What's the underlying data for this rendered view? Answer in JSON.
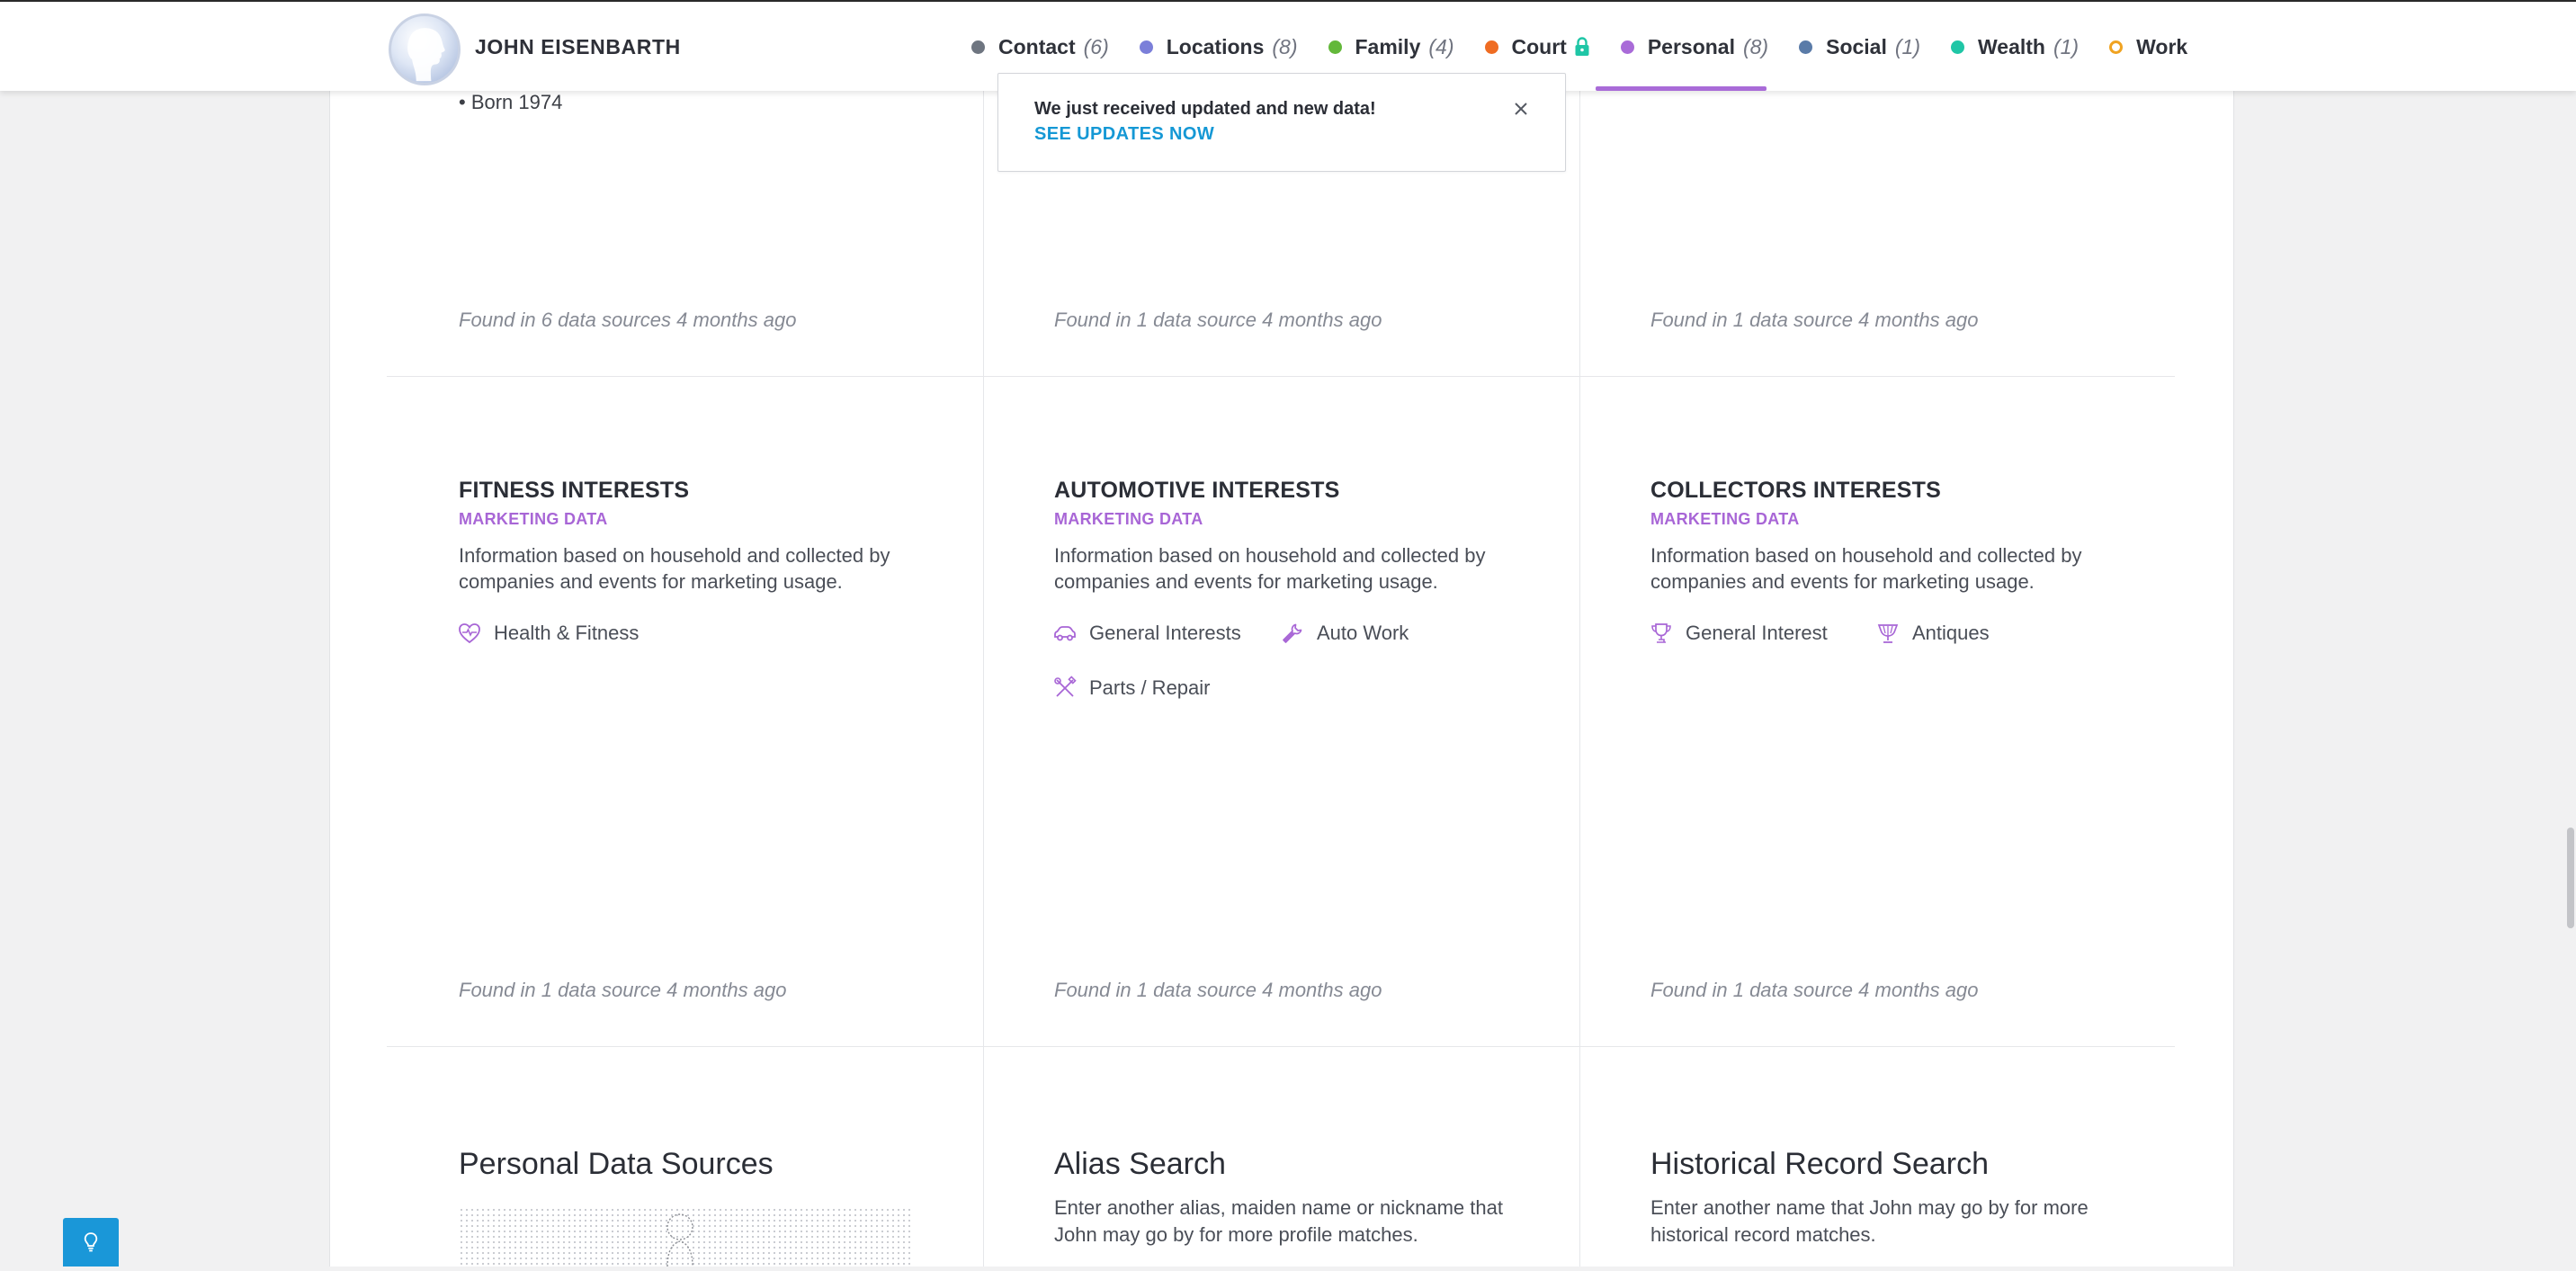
{
  "header": {
    "profile_name": "JOHN EISENBARTH",
    "nav": [
      {
        "label": "Contact",
        "count": "(6)",
        "color": "#6e7580",
        "icon": "dot"
      },
      {
        "label": "Locations",
        "count": "(8)",
        "color": "#7b7fd9",
        "icon": "dot"
      },
      {
        "label": "Family",
        "count": "(4)",
        "color": "#63b83a",
        "icon": "dot"
      },
      {
        "label": "Court",
        "count": "",
        "color": "#ef6c22",
        "icon": "dot",
        "locked": true
      },
      {
        "label": "Personal",
        "count": "(8)",
        "color": "#a96bd8",
        "icon": "dot",
        "active": true
      },
      {
        "label": "Social",
        "count": "(1)",
        "color": "#5a7ba8",
        "icon": "dot"
      },
      {
        "label": "Wealth",
        "count": "(1)",
        "color": "#1fc6a6",
        "icon": "dot"
      },
      {
        "label": "Work",
        "count": "",
        "color": "#f0a321",
        "icon": "hollow-dot"
      }
    ]
  },
  "toast": {
    "message": "We just received updated and new data!",
    "link": "SEE UPDATES NOW"
  },
  "top_row": {
    "born": "• Born 1974",
    "found": [
      "Found in 6 data sources 4 months ago",
      "Found in 1 data source 4 months ago",
      "Found in 1 data source 4 months ago"
    ]
  },
  "cards": [
    {
      "title": "FITNESS INTERESTS",
      "subtitle": "MARKETING DATA",
      "desc": "Information based on household and collected by companies and events for marketing usage.",
      "tags": [
        {
          "label": "Health & Fitness",
          "icon": "heart-pulse-icon"
        }
      ],
      "found": "Found in 1 data source 4 months ago"
    },
    {
      "title": "AUTOMOTIVE INTERESTS",
      "subtitle": "MARKETING DATA",
      "desc": "Information based on household and collected by companies and events for marketing usage.",
      "tags": [
        {
          "label": "General Interests",
          "icon": "car-icon"
        },
        {
          "label": "Auto Work",
          "icon": "wrench-icon"
        },
        {
          "label": "Parts / Repair",
          "icon": "tools-icon"
        }
      ],
      "found": "Found in 1 data source 4 months ago"
    },
    {
      "title": "COLLECTORS INTERESTS",
      "subtitle": "MARKETING DATA",
      "desc": "Information based on household and collected by companies and events for marketing usage.",
      "tags": [
        {
          "label": "General Interest",
          "icon": "trophy-icon"
        },
        {
          "label": "Antiques",
          "icon": "chalice-icon"
        }
      ],
      "found": "Found in 1 data source 4 months ago"
    }
  ],
  "tools": [
    {
      "title": "Personal Data Sources",
      "desc": ""
    },
    {
      "title": "Alias Search",
      "desc": "Enter another alias, maiden name or nickname that John may go by for more profile matches."
    },
    {
      "title": "Historical Record Search",
      "desc": "Enter another name that John may go by for more historical record matches."
    }
  ],
  "colors": {
    "accent": "#a96bd8",
    "link": "#1598d5",
    "help_button": "#1a97d8"
  }
}
